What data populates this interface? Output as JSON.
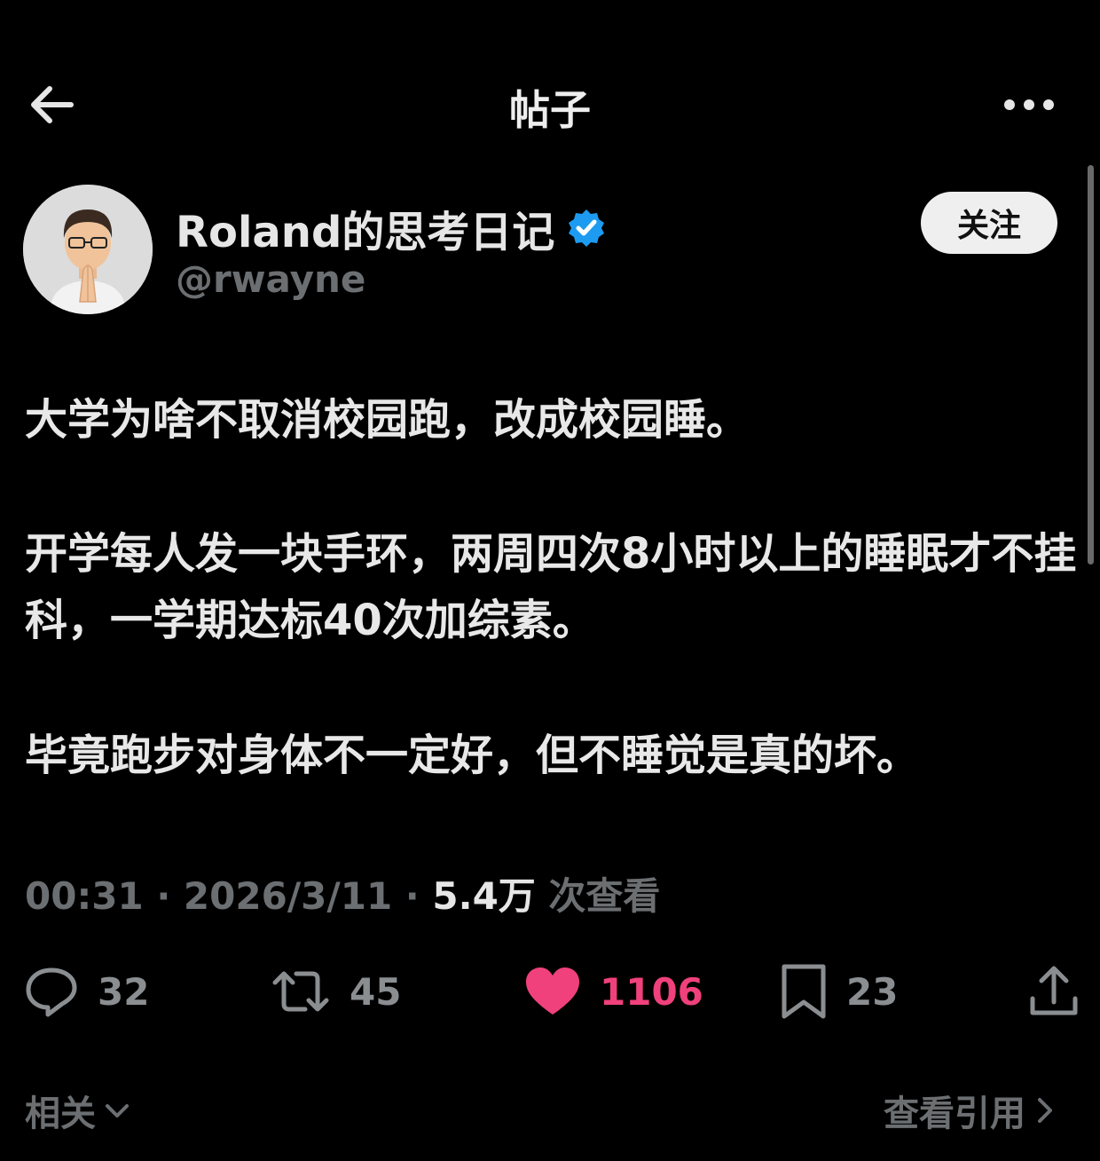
{
  "header": {
    "title": "帖子",
    "back_icon": "arrow-left-icon",
    "more_icon": "more-horizontal-icon"
  },
  "author": {
    "name": "Roland的思考日记",
    "handle": "@rwayne",
    "verified_icon": "verified-badge-icon",
    "follow_label": "关注"
  },
  "post": {
    "paragraphs": [
      "大学为啥不取消校园跑，改成校园睡。",
      "开学每人发一块手环，两周四次8小时以上的睡眠才不挂科，一学期达标40次加综素。",
      "毕竟跑步对身体不一定好，但不睡觉是真的坏。"
    ],
    "time": "00:31",
    "date": "2026/3/11",
    "views": "5.4万",
    "views_label": "次查看",
    "separator": "·"
  },
  "actions": {
    "replies": "32",
    "retweets": "45",
    "likes": "1106",
    "bookmarks": "23"
  },
  "footer": {
    "related": "相关",
    "view_quotes": "查看引用"
  },
  "colors": {
    "background": "#000000",
    "like": "#f0417c",
    "verified": "#1d9bf0",
    "muted": "#6c6f72"
  }
}
